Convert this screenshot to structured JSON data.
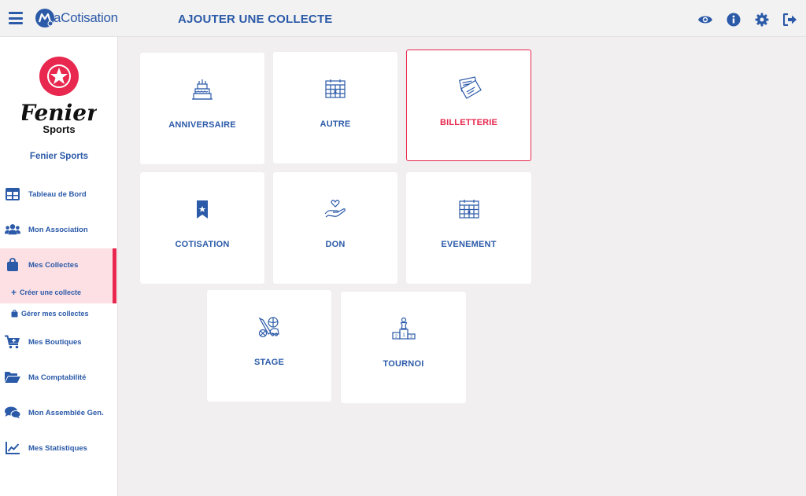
{
  "app": {
    "brand_prefix": "M",
    "brand_name": "aCotisation"
  },
  "header": {
    "title": "AJOUTER UNE COLLECTE"
  },
  "club": {
    "logo_word1": "Fenier",
    "logo_word2": "Sports",
    "name": "Fenier Sports"
  },
  "nav": {
    "dashboard": "Tableau de Bord",
    "association": "Mon Association",
    "collectes": "Mes Collectes",
    "create_collecte": "Créer une collecte",
    "manage_collectes": "Gérer mes collectes",
    "boutiques": "Mes Boutiques",
    "comptabilite": "Ma Comptabilité",
    "assemblee": "Mon Assemblée Gen.",
    "statistiques": "Mes Statistiques"
  },
  "cards": {
    "anniversaire": "ANNIVERSAIRE",
    "autre": "AUTRE",
    "billetterie": "BILLETTERIE",
    "cotisation": "COTISATION",
    "don": "DON",
    "evenement": "EVENEMENT",
    "stage": "STAGE",
    "tournoi": "TOURNOI"
  },
  "colors": {
    "primary": "#2b5aa8",
    "accent": "#e8284e",
    "active_bg": "#fde0e4"
  },
  "selected_card": "billetterie"
}
